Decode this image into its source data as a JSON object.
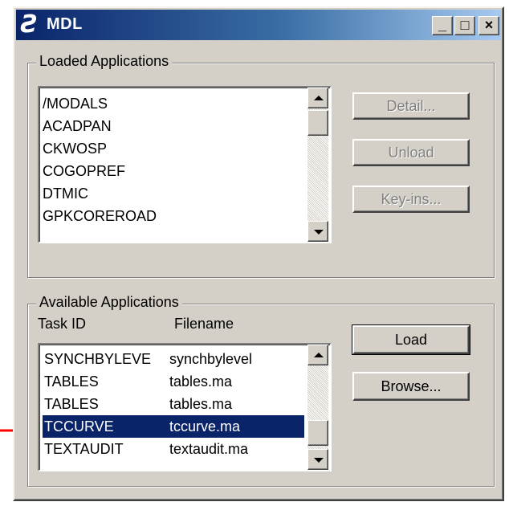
{
  "window": {
    "title": "MDL",
    "minimize_glyph": "_",
    "maximize_glyph": "□",
    "close_glyph": "×"
  },
  "loaded": {
    "group_label": "Loaded Applications",
    "items": [
      "/MODALS",
      "ACADPAN",
      "CKWOSP",
      "COGOPREF",
      "DTMIC",
      "GPKCOREROAD"
    ],
    "buttons": {
      "detail": "Detail...",
      "unload": "Unload",
      "keyins": "Key-ins..."
    }
  },
  "available": {
    "group_label": "Available Applications",
    "col_task": "Task ID",
    "col_file": "Filename",
    "rows": [
      {
        "task": "SYNCHBYLEVE",
        "file": "synchbylevel"
      },
      {
        "task": "TABLES",
        "file": "tables.ma"
      },
      {
        "task": "TABLES",
        "file": "tables.ma"
      },
      {
        "task": "TCCURVE",
        "file": "tccurve.ma"
      },
      {
        "task": "TEXTAUDIT",
        "file": "textaudit.ma"
      }
    ],
    "selected_index": 3,
    "buttons": {
      "load": "Load",
      "browse": "Browse..."
    }
  },
  "colors": {
    "titlebar_start": "#0a246a",
    "titlebar_end": "#a6caf0",
    "face": "#d4d0c8",
    "selection": "#0a246a",
    "annotation_arrow": "#ff0000"
  },
  "icons": [
    "app-logo-icon",
    "scroll-up-arrow-icon",
    "scroll-down-arrow-icon",
    "red-pointer-arrow-icon"
  ]
}
